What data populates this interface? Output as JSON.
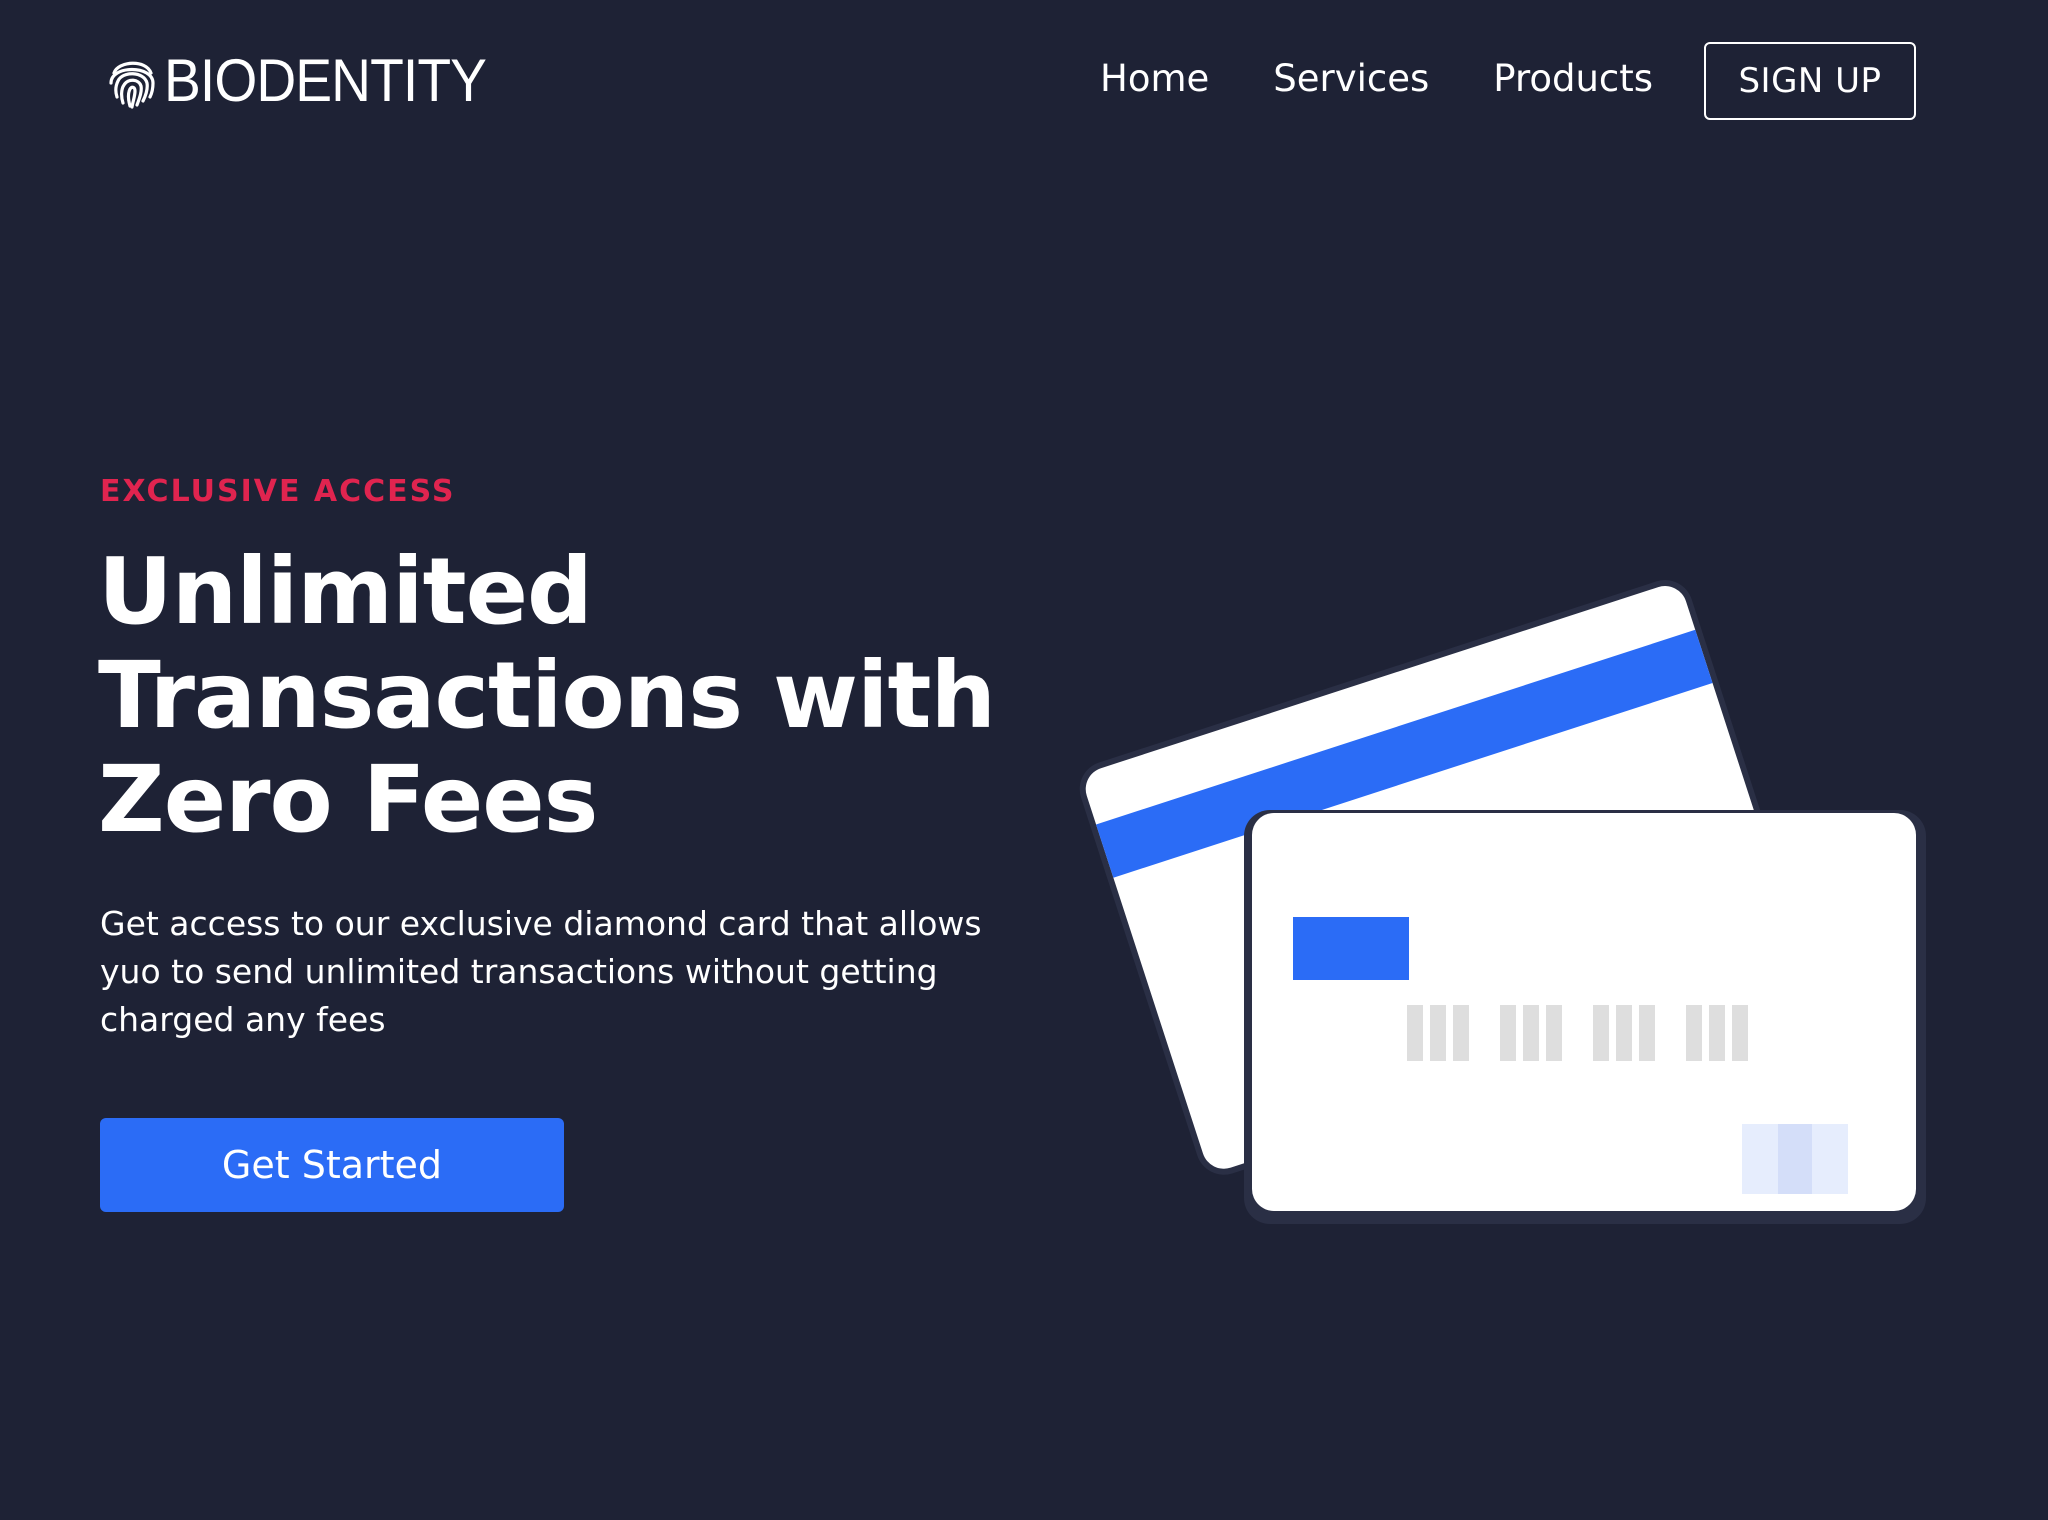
{
  "brand": {
    "name": "BIODENTITY",
    "icon": "fingerprint-icon"
  },
  "nav": {
    "links": [
      {
        "label": "Home"
      },
      {
        "label": "Services"
      },
      {
        "label": "Products"
      }
    ],
    "signup_label": "SIGN UP"
  },
  "hero": {
    "eyebrow": "EXCLUSIVE ACCESS",
    "headline_lines": [
      "Unlimited",
      "Transactions with",
      "Zero Fees"
    ],
    "subtext": "Get access to our exclusive diamond card that allows yuo to send unlimited transactions without getting charged any fees",
    "cta_label": "Get Started"
  },
  "colors": {
    "background": "#1e2235",
    "accent": "#2b6cf6",
    "eyebrow": "#e0244f",
    "card": "#ffffff"
  }
}
